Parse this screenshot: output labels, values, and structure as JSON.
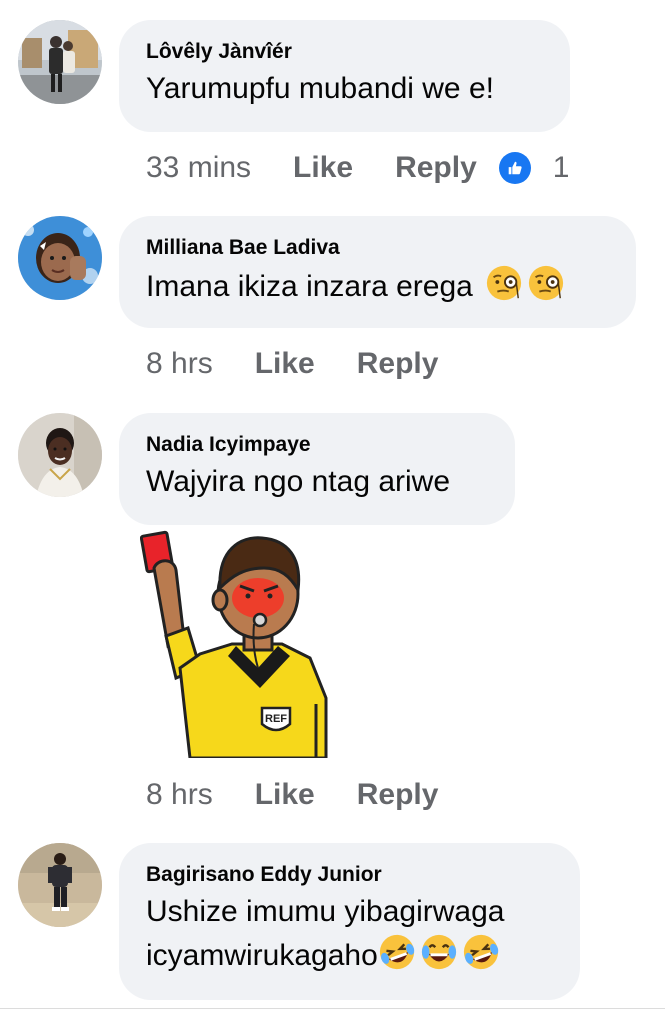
{
  "actions": {
    "like_label": "Like",
    "reply_label": "Reply"
  },
  "comments": [
    {
      "author": "Lôvêly Jànvîér",
      "text": "Yarumupfu mubandi we e!",
      "time": "33 mins",
      "reaction_count": "1"
    },
    {
      "author": "Milliana Bae Ladiva",
      "text": "Imana ikiza inzara erega",
      "time": "8 hrs",
      "emoji": [
        "monocle-face",
        "monocle-face"
      ]
    },
    {
      "author": "Nadia Icyimpaye",
      "text": "Wajyira ngo ntag ariwe",
      "time": "8 hrs",
      "sticker": {
        "badge_text": "REF"
      }
    },
    {
      "author": "Bagirisano Eddy Junior",
      "text_line1": "Ushize imumu yibagirwaga",
      "text_line2": "icyamwirukagaho",
      "emoji": [
        "rolling-laughing-face",
        "tears-of-joy-face",
        "rolling-laughing-face"
      ]
    }
  ],
  "colors": {
    "bubble": "#f0f2f5",
    "meta_text": "#65676b",
    "like_blue": "#1877f2",
    "referee_shirt": "#f6d81b",
    "red_card": "#e8232a"
  }
}
